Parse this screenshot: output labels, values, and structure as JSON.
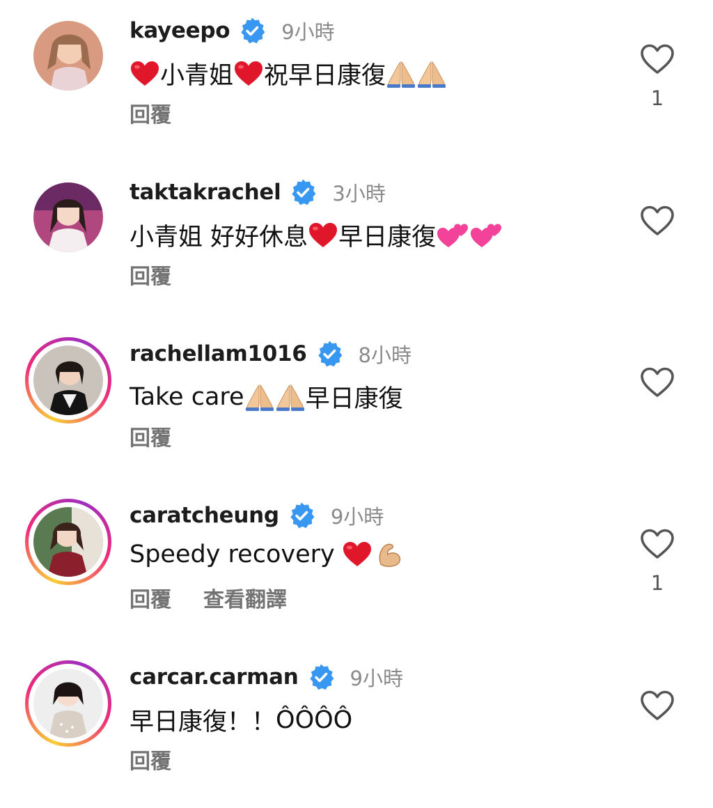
{
  "ui": {
    "reply_label": "回覆",
    "translate_label": "查看翻譯",
    "verified_color": "#3897f0",
    "like_icon": "heart-outline-icon"
  },
  "comments": [
    {
      "username": "kayeepo",
      "time": "9小時",
      "text_a": "小青姐",
      "text_b": "祝早日康復",
      "like_count": "1",
      "story_ring": false
    },
    {
      "username": "taktakrachel",
      "time": "3小時",
      "text_a": "小青姐 好好休息",
      "text_b": "早日康復",
      "like_count": "",
      "story_ring": false
    },
    {
      "username": "rachellam1016",
      "time": "8小時",
      "text_a": "Take care",
      "text_b": "早日康復",
      "like_count": "",
      "story_ring": true
    },
    {
      "username": "caratcheung",
      "time": "9小時",
      "text_a": "Speedy recovery",
      "text_b": "",
      "like_count": "1",
      "story_ring": true,
      "has_translate": true
    },
    {
      "username": "carcar.carman",
      "time": "9小時",
      "text_a": "早日康復！！",
      "text_b": "",
      "text_c": "ÔÔÔÔ",
      "like_count": "",
      "story_ring": true
    }
  ]
}
